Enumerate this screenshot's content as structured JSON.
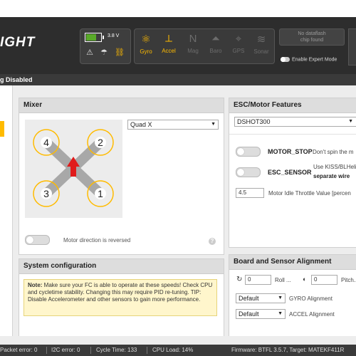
{
  "app": {
    "logo_text": "IGHT",
    "arming_status": "g Disabled"
  },
  "header": {
    "battery_voltage": "3.8 V",
    "battery_level": 0.7,
    "status_icons": [
      "warning-icon",
      "parachute-icon",
      "link-icon"
    ],
    "sensors": [
      {
        "label": "Gyro",
        "glyph": "⚛",
        "active": true
      },
      {
        "label": "Accel",
        "glyph": "⟂",
        "active": true
      },
      {
        "label": "Mag",
        "glyph": "N",
        "active": false
      },
      {
        "label": "Baro",
        "glyph": "⏶",
        "active": false
      },
      {
        "label": "GPS",
        "glyph": "⌖",
        "active": false
      },
      {
        "label": "Sonar",
        "glyph": "≋",
        "active": false
      }
    ],
    "dataflash_line1": "No dataflash",
    "dataflash_line2": "chip found",
    "expert_mode_label": "Enable Expert Mode",
    "accent_color": "#ffbb00"
  },
  "mixer": {
    "title": "Mixer",
    "selected": "Quad X",
    "motors": [
      "4",
      "2",
      "3",
      "1"
    ],
    "direction_label": "Motor direction is reversed",
    "help": "?"
  },
  "system": {
    "title": "System configuration",
    "note_bold": "Note:",
    "note_text": " Make sure your FC is able to operate at these speeds! Check CPU and cycletime stability. Changing this may require PID re-tuning. TIP: Disable Accelerometer and other sensors to gain more performance."
  },
  "esc": {
    "title": "ESC/Motor Features",
    "protocol": "DSHOT300",
    "motor_stop_label": "MOTOR_STOP",
    "motor_stop_desc": "Don't spin the m",
    "esc_sensor_label": "ESC_SENSOR",
    "esc_sensor_desc1": "Use KISS/BLHeli_",
    "esc_sensor_desc2": "separate wire",
    "idle_value": "4.5",
    "idle_label": "Motor Idle Throttle Value [percen"
  },
  "board": {
    "title": "Board and Sensor Alignment",
    "roll_value": "0",
    "roll_label": "Roll ...",
    "pitch_value": "0",
    "pitch_label": "Pitch...",
    "gyro_select": "Default",
    "gyro_label": "GYRO Alignment",
    "accel_select": "Default",
    "accel_label": "ACCEL Alignment"
  },
  "status": {
    "packet_error": "Packet error: 0",
    "i2c_error": "I2C error: 0",
    "cycle_time": "Cycle Time: 133",
    "cpu_load": "CPU Load: 14%",
    "firmware": "Firmware: BTFL 3.5.7, Target: MATEKF411R"
  }
}
